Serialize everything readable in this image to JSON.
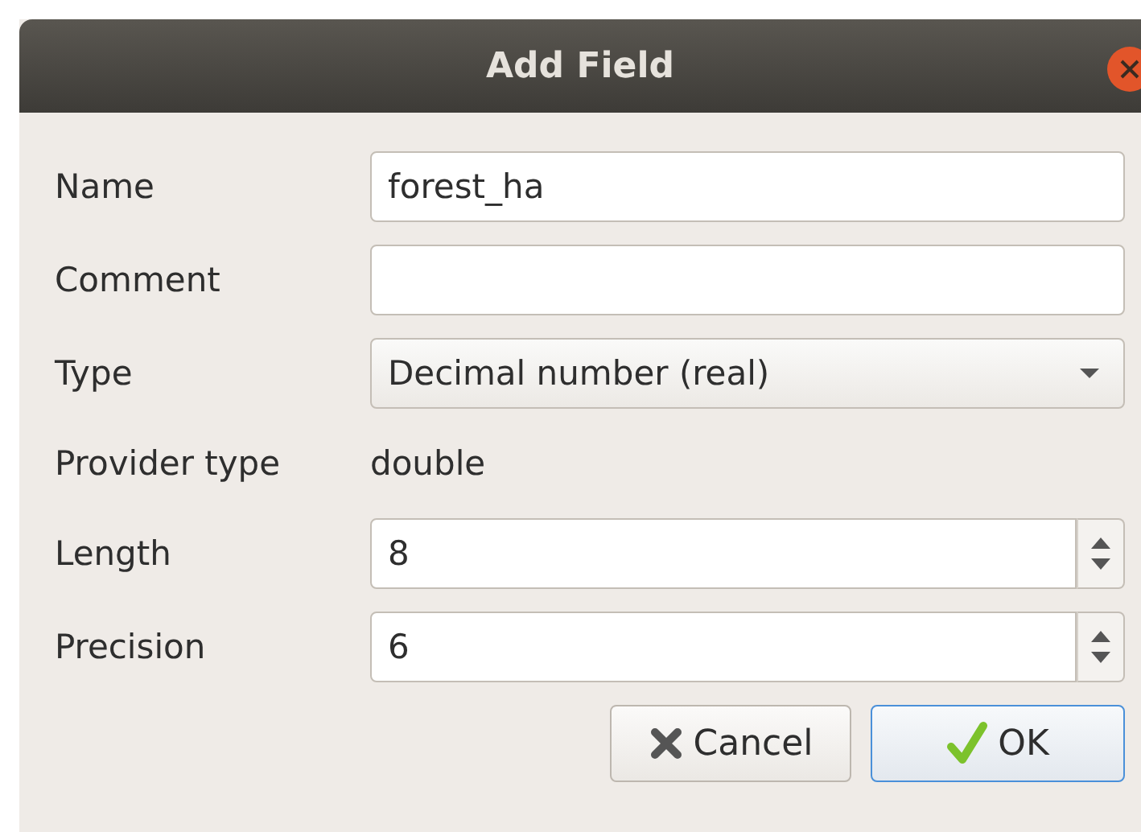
{
  "window": {
    "title": "Add Field"
  },
  "fields": [
    {
      "label": "Name",
      "kind": "text",
      "value": "forest_ha"
    },
    {
      "label": "Comment",
      "kind": "text"
    },
    {
      "label": "Type",
      "kind": "combo",
      "value": "Decimal number (real)"
    },
    {
      "label": "Provider type",
      "kind": "readonly",
      "value": "double"
    },
    {
      "label": "Length",
      "kind": "spin",
      "value": "8"
    },
    {
      "label": "Precision",
      "kind": "spin",
      "value": "6"
    }
  ],
  "buttons": [
    {
      "label": "Cancel",
      "kind": "cancel",
      "default": false
    },
    {
      "label": "OK",
      "kind": "ok",
      "default": true
    }
  ]
}
